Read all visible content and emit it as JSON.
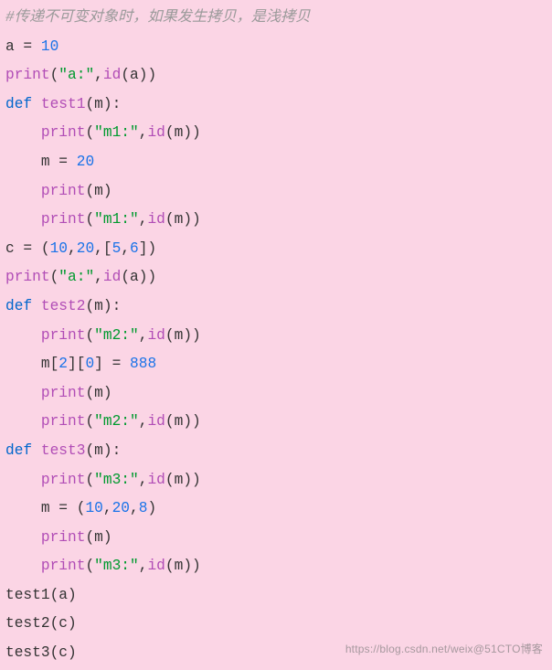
{
  "code": {
    "l01_comment": "#传递不可变对象时，如果发生拷贝，是浅拷贝",
    "l02_a": "a",
    "l02_eq": " = ",
    "l02_v": "10",
    "l03_print": "print",
    "l03_s": "\"a:\"",
    "l03_id": "id",
    "l03_a": "a",
    "l04_def": "def ",
    "l04_fn": "test1",
    "l04_p": "m",
    "l05_print": "print",
    "l05_s": "\"m1:\"",
    "l05_id": "id",
    "l05_m": "m",
    "l06_m": "m",
    "l06_eq": " = ",
    "l06_v": "20",
    "l07_print": "print",
    "l07_m": "m",
    "l08_print": "print",
    "l08_s": "\"m1:\"",
    "l08_id": "id",
    "l08_m": "m",
    "l09_c": "c",
    "l09_eq": " = (",
    "l09_n1": "10",
    "l09_n2": "20",
    "l09_n3": "5",
    "l09_n4": "6",
    "l10_print": "print",
    "l10_s": "\"a:\"",
    "l10_id": "id",
    "l10_a": "a",
    "l11_def": "def ",
    "l11_fn": "test2",
    "l11_p": "m",
    "l12_print": "print",
    "l12_s": "\"m2:\"",
    "l12_id": "id",
    "l12_m": "m",
    "l13_m": "m",
    "l13_i1": "2",
    "l13_i2": "0",
    "l13_v": "888",
    "l14_print": "print",
    "l14_m": "m",
    "l15_print": "print",
    "l15_s": "\"m2:\"",
    "l15_id": "id",
    "l15_m": "m",
    "l16_def": "def ",
    "l16_fn": "test3",
    "l16_p": "m",
    "l17_print": "print",
    "l17_s": "\"m3:\"",
    "l17_id": "id",
    "l17_m": "m",
    "l18_m": "m",
    "l18_n1": "10",
    "l18_n2": "20",
    "l18_n3": "8",
    "l19_print": "print",
    "l19_m": "m",
    "l20_print": "print",
    "l20_s": "\"m3:\"",
    "l20_id": "id",
    "l20_m": "m",
    "l21": "test1(a)",
    "l22": "test2(c)",
    "l23": "test3(c)"
  },
  "watermark": "https://blog.csdn.net/weix@51CTO博客"
}
